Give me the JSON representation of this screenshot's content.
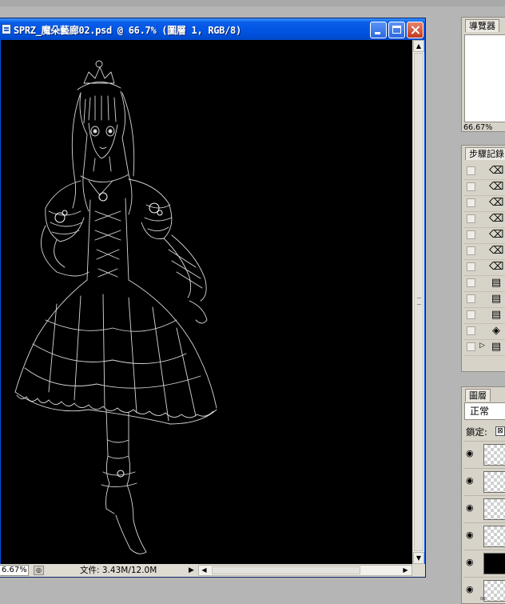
{
  "document": {
    "title": "SPRZ_魔朵藝廊02.psd @ 66.7% (圖層 1, RGB/8)",
    "zoom": "6.67%",
    "file_info": "文件: 3.43M/12.0M"
  },
  "palettes": {
    "navigator": {
      "tab": "導覽器",
      "zoom": "66.67%"
    },
    "history": {
      "tab": "步驟記錄",
      "steps": [
        {
          "icon": "eraser-icon",
          "glyph": "⌫"
        },
        {
          "icon": "eraser-icon",
          "glyph": "⌫"
        },
        {
          "icon": "eraser-icon",
          "glyph": "⌫"
        },
        {
          "icon": "eraser-icon",
          "glyph": "⌫"
        },
        {
          "icon": "eraser-icon",
          "glyph": "⌫"
        },
        {
          "icon": "eraser-icon",
          "glyph": "⌫"
        },
        {
          "icon": "eraser-icon",
          "glyph": "⌫"
        },
        {
          "icon": "document-icon",
          "glyph": "▤"
        },
        {
          "icon": "document-icon",
          "glyph": "▤"
        },
        {
          "icon": "document-icon",
          "glyph": "▤"
        },
        {
          "icon": "paint-bucket-icon",
          "glyph": "◈"
        },
        {
          "icon": "document-icon",
          "glyph": "▤",
          "current": true
        }
      ]
    },
    "layers": {
      "tab": "圖層",
      "blend_mode": "正常",
      "lock_label": "鎖定:",
      "rows": [
        {
          "visible": true,
          "thumbnail": "transparent"
        },
        {
          "visible": true,
          "thumbnail": "transparent"
        },
        {
          "visible": true,
          "thumbnail": "transparent"
        },
        {
          "visible": true,
          "thumbnail": "transparent"
        },
        {
          "visible": true,
          "thumbnail": "black"
        },
        {
          "visible": true,
          "thumbnail": "transparent"
        }
      ]
    }
  }
}
